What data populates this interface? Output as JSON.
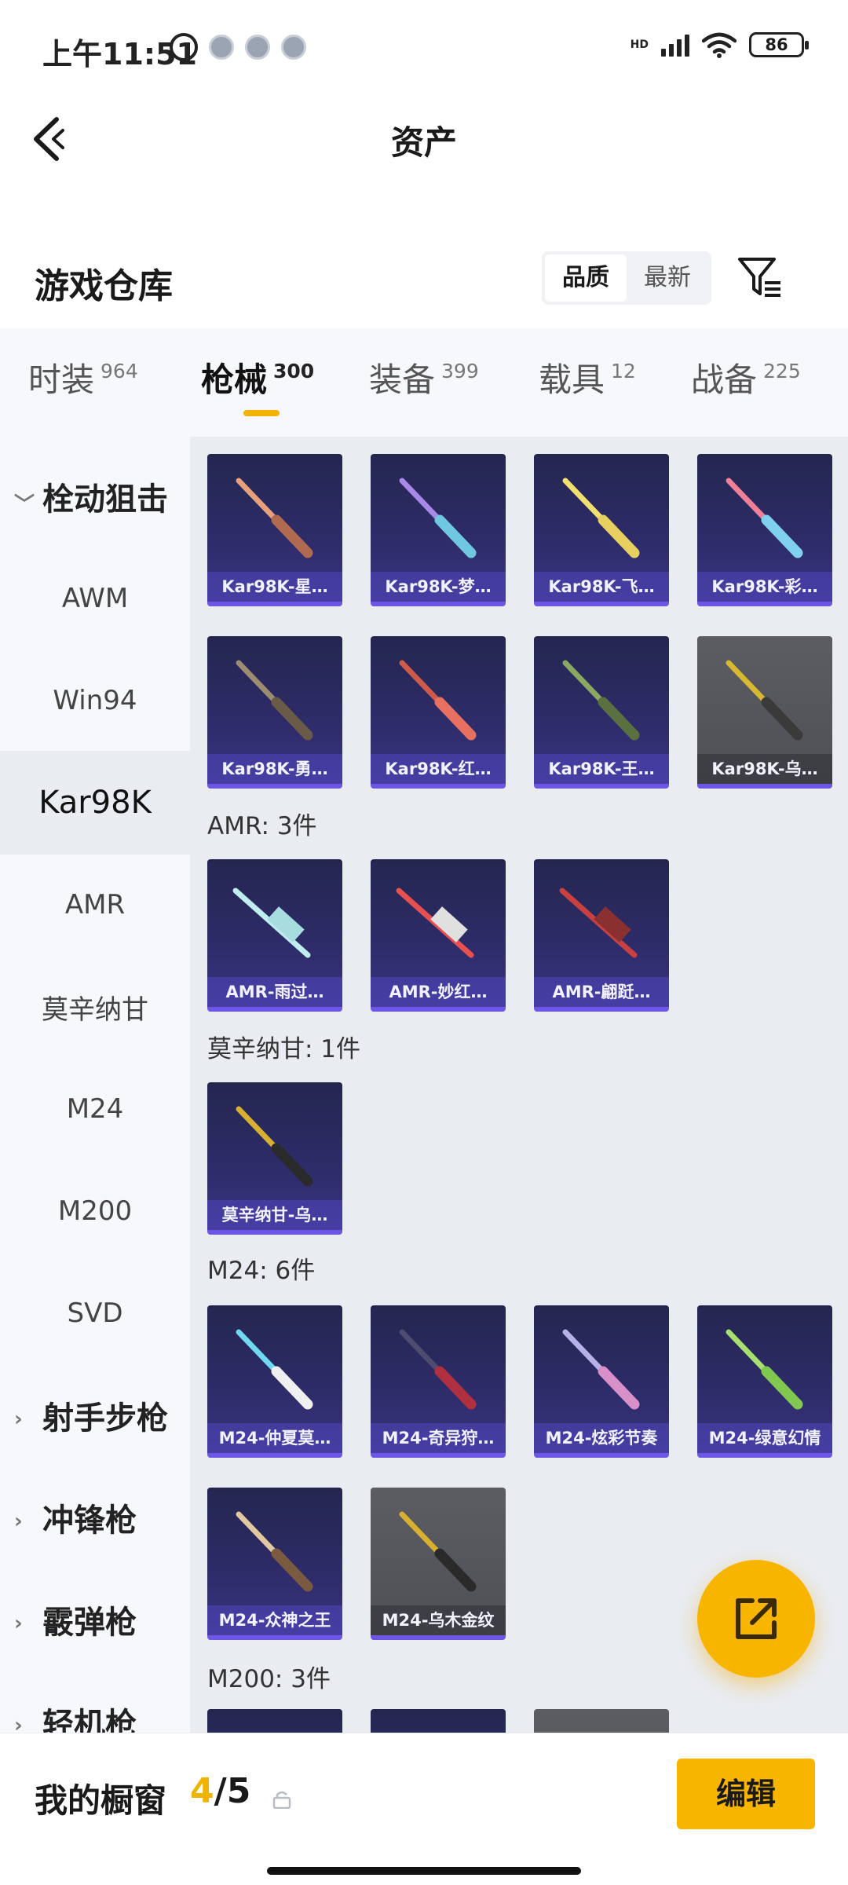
{
  "status_bar": {
    "time": "上午11:51",
    "network": "HD",
    "battery": "86"
  },
  "header": {
    "title": "资产"
  },
  "warehouse": {
    "title": "游戏仓库",
    "sort_options": [
      "品质",
      "最新"
    ]
  },
  "tabs": [
    {
      "label": "时装",
      "count": "964"
    },
    {
      "label": "枪械",
      "count": "300"
    },
    {
      "label": "装备",
      "count": "399"
    },
    {
      "label": "载具",
      "count": "12"
    },
    {
      "label": "战备",
      "count": "225"
    }
  ],
  "sidebar": {
    "groups": [
      "栓动狙击",
      "射手步枪",
      "冲锋枪",
      "霰弹枪",
      "轻机枪"
    ],
    "items": [
      "AWM",
      "Win94",
      "Kar98K",
      "AMR",
      "莫辛纳甘",
      "M24",
      "M200",
      "SVD"
    ],
    "active": "Kar98K"
  },
  "sections": [
    {
      "label": "",
      "items": [
        "Kar98K-星…",
        "Kar98K-梦…",
        "Kar98K-飞…",
        "Kar98K-彩…",
        "Kar98K-勇…",
        "Kar98K-红…",
        "Kar98K-王…",
        "Kar98K-乌…"
      ]
    },
    {
      "label": "AMR: 3件",
      "items": [
        "AMR-雨过…",
        "AMR-妙红…",
        "AMR-翩跹…"
      ]
    },
    {
      "label": "莫辛纳甘: 1件",
      "items": [
        "莫辛纳甘-乌…"
      ]
    },
    {
      "label": "M24: 6件",
      "items": [
        "M24-仲夏莫…",
        "M24-奇异狩…",
        "M24-炫彩节奏",
        "M24-绿意幻情",
        "M24-众神之王",
        "M24-乌木金纹"
      ]
    },
    {
      "label": "M200: 3件",
      "items": []
    }
  ],
  "showcase": {
    "label": "我的橱窗",
    "current": "4",
    "total": "/5",
    "edit_label": "编辑"
  },
  "colors": {
    "accent": "#f8b500",
    "card_bg": "#2e2c6a",
    "card_border": "#6d56e6",
    "sidebar_bg": "#f6f8fb",
    "content_bg": "#e9ecf1"
  }
}
